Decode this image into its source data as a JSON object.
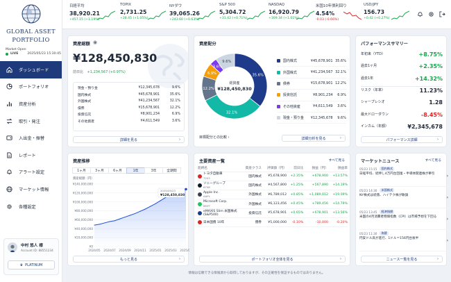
{
  "brand": {
    "line1": "GLOBAL ASSET",
    "line2": "PORTFOLIO"
  },
  "market": {
    "label": "Market Open",
    "live": "LIVE",
    "time": "2025/05/23 15:30:45"
  },
  "nav": [
    {
      "label": "ダッシュボード",
      "icon": "home-icon",
      "active": true
    },
    {
      "label": "ポートフォリオ",
      "icon": "pie-icon"
    },
    {
      "label": "資産分析",
      "icon": "bar-chart-icon"
    },
    {
      "label": "取引・発注",
      "icon": "swap-icon"
    },
    {
      "label": "入出金・振替",
      "icon": "wallet-icon"
    },
    {
      "label": "レポート",
      "icon": "document-icon"
    },
    {
      "label": "アラート設定",
      "icon": "bell-icon"
    },
    {
      "label": "マーケット情報",
      "icon": "globe-icon"
    },
    {
      "label": "各種設定",
      "icon": "gear-icon"
    }
  ],
  "user": {
    "name": "中村 悠人 様",
    "id": "Account ID: 88551234",
    "tier": "PLATINUM"
  },
  "tickers": [
    {
      "name": "日経平均",
      "value": "38,920.21",
      "change": "+457.15 (+1.19%)",
      "dir": "up"
    },
    {
      "name": "TOPIX",
      "value": "2,731.25",
      "change": "+28.45 (+1.05%)",
      "dir": "up"
    },
    {
      "name": "NYダウ",
      "value": "39,065.26",
      "change": "+243.60 (+0.63%)",
      "dir": "up"
    },
    {
      "name": "S&P 500",
      "value": "5,304.72",
      "change": "+31.42 (+0.71%)",
      "dir": "up"
    },
    {
      "name": "NASDAQ",
      "value": "16,920.79",
      "change": "+169.34 (+1.01%)",
      "dir": "up"
    },
    {
      "name": "米国10年債利回り",
      "value": "4.54%",
      "change": "-0.03 (-0.66%)",
      "dir": "dn"
    },
    {
      "name": "USD/JPY",
      "value": "156.73",
      "change": "+0.42 (+0.27%)",
      "dir": "up"
    }
  ],
  "total": {
    "title": "資産総額",
    "value": "¥128,450,830",
    "prev_label": "前日比",
    "prev": "+1,234,567 (+0.97%)",
    "button": "詳細を見る",
    "rows": [
      {
        "k": "現金・預り金",
        "v": "¥12,345,678",
        "p": "9.6%"
      },
      {
        "k": "国内株式",
        "v": "¥45,678,901",
        "p": "35.6%"
      },
      {
        "k": "外国株式",
        "v": "¥41,234,567",
        "p": "32.1%"
      },
      {
        "k": "債券",
        "v": "¥15,678,901",
        "p": "12.2%"
      },
      {
        "k": "投資信託",
        "v": "¥8,901,234",
        "p": "6.9%"
      },
      {
        "k": "その他資産",
        "v": "¥4,611,549",
        "p": "3.6%"
      }
    ]
  },
  "alloc": {
    "title": "資産配分",
    "center_label": "総資産",
    "center_value": "¥128,450,830",
    "compare": "目標配分との比較",
    "button": "詳細分析を見る",
    "items": [
      {
        "label": "国内株式",
        "value": "¥45,678,901",
        "pct": "35.6%",
        "color": "#1e3a8a"
      },
      {
        "label": "外国株式",
        "value": "¥41,234,567",
        "pct": "32.1%",
        "color": "#14b8a6"
      },
      {
        "label": "債券",
        "value": "¥15,678,901",
        "pct": "12.2%",
        "color": "#64748b"
      },
      {
        "label": "投資信託",
        "value": "¥8,901,234",
        "pct": "6.9%",
        "color": "#f59e0b"
      },
      {
        "label": "その他資産",
        "value": "¥4,611,549",
        "pct": "3.6%",
        "color": "#7c3aed"
      },
      {
        "label": "現金・預り金",
        "value": "¥12,345,678",
        "pct": "9.6%",
        "color": "#cbd5e1"
      }
    ]
  },
  "perf": {
    "title": "パフォーマンスサマリー",
    "button": "パフォーマンス詳細",
    "rows": [
      {
        "k": "年初来（YTD）",
        "v": "+8.75%",
        "c": "up"
      },
      {
        "k": "過去1ヶ月",
        "v": "+2.35%",
        "c": "up"
      },
      {
        "k": "過去1年",
        "v": "+14.32%",
        "c": "up"
      },
      {
        "k": "リスク（年率）",
        "v": "11.23%",
        "c": ""
      },
      {
        "k": "シャープレシオ",
        "v": "1.28",
        "c": ""
      },
      {
        "k": "最大ドローダウン",
        "v": "-8.45%",
        "c": "dn"
      },
      {
        "k": "インカム（年額）",
        "v": "¥2,345,678",
        "c": ""
      }
    ]
  },
  "trend": {
    "title": "資産推移",
    "tabs": [
      "1ヶ月",
      "3ヶ月",
      "6ヶ月",
      "1年",
      "3年",
      "全期間"
    ],
    "active_tab": "1年",
    "ylabel": "資産総額（円）",
    "tooltip_date": "2025/05/23",
    "tooltip_value": "¥128,450,830",
    "button": "もっと見る"
  },
  "chart_data": {
    "type": "area",
    "ylabel": "資産総額（円）",
    "yticks": [
      "¥140,000,000",
      "¥120,000,000",
      "¥100,000,000",
      "¥80,000,000",
      "¥60,000,000",
      "¥40,000,000",
      "¥20,000,000",
      "¥0"
    ],
    "ylim": [
      0,
      140000000
    ],
    "x": [
      "2024/05",
      "2024/07",
      "2024/09",
      "2024/11",
      "2025/01",
      "2025/03",
      "2025/05"
    ],
    "values": [
      48000000,
      50000000,
      53000000,
      56000000,
      58000000,
      62000000,
      66000000,
      70000000,
      74000000,
      79000000,
      84000000,
      90000000,
      96000000,
      103000000,
      110000000,
      116000000,
      121000000,
      124000000,
      128450830
    ]
  },
  "holdings": {
    "title": "主要資産一覧",
    "more": "すべて見る",
    "button": "ポートフォリオ全体を見る",
    "headers": [
      "銘柄名",
      "資産クラス",
      "評価額（円）",
      "前日比",
      "損益（円）",
      "損益率"
    ],
    "rows": [
      {
        "name": "トヨタ自動車",
        "code": "7203",
        "cls": "国内株式",
        "val": "¥5,678,900",
        "chg": "+2.35%",
        "pl": "+678,900",
        "plr": "+13.57%",
        "color": "#dc2626"
      },
      {
        "name": "ソニーグループ",
        "code": "6758",
        "cls": "国内株式",
        "val": "¥4,567,800",
        "chg": "+1.25%",
        "pl": "+567,890",
        "plr": "+14.19%",
        "color": "#111827"
      },
      {
        "name": "Apple Inc.",
        "code": "AAPL",
        "cls": "外国株式",
        "val": "¥6,789,012",
        "chg": "+0.85%",
        "pl": "+1,089,012",
        "plr": "+19.09%",
        "color": "#374151"
      },
      {
        "name": "Microsoft Corp.",
        "code": "MSFT",
        "cls": "外国株式",
        "val": "¥6,123,456",
        "chg": "+0.45%",
        "pl": "+789,456",
        "plr": "+14.79%",
        "color": "#22c55e"
      },
      {
        "name": "eMAXIS Slim 米国株式(S&P500)",
        "code": "",
        "cls": "投資信託",
        "val": "¥5,678,901",
        "chg": "+0.65%",
        "pl": "+678,901",
        "plr": "+13.56%",
        "color": "#1e3a8a"
      },
      {
        "name": "日本国債 10年",
        "code": "",
        "cls": "債券",
        "val": "¥5,000,000",
        "chg": "-0.10%",
        "pl": "-10,000",
        "plr": "-0.20%",
        "color": "#dc2626"
      }
    ]
  },
  "news": {
    "title": "マーケットニュース",
    "more": "すべて見る",
    "button": "ニュース一覧を見る",
    "items": [
      {
        "date": "05/23 15:15",
        "tag": "国内株式",
        "text": "日経平均、続伸し4万円台回復・半導体関連株が牽引"
      },
      {
        "date": "05/23 14:30",
        "tag": "米国株式",
        "text": "NY株式は続落、ハイテク株が軟調"
      },
      {
        "date": "05/23 13:45",
        "tag": "経済指標",
        "text": "米国の4月消費者物価指数（CPI）は市場予想を下回る"
      },
      {
        "date": "05/23 11:30",
        "tag": "為替",
        "text": "円安ドル高が進行、1ドル＝156円台後半"
      }
    ]
  },
  "footer": "情報は信頼できる情報源から取得しておりますが、その正確性を保証するものではありません。"
}
